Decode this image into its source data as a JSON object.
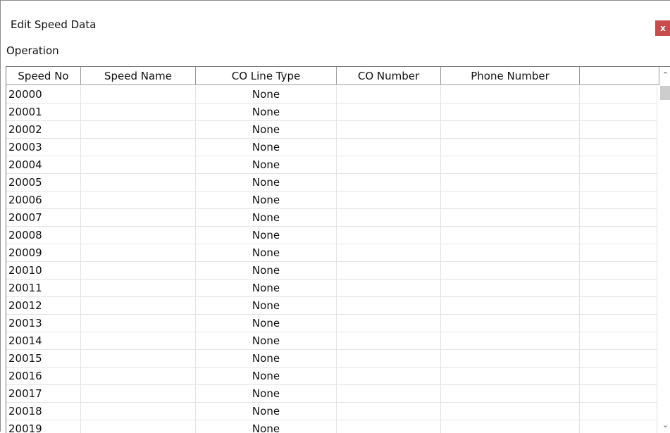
{
  "window": {
    "title": "Edit Speed Data",
    "close_label": "x"
  },
  "menu": {
    "items": [
      "Operation"
    ]
  },
  "table": {
    "columns": [
      "Speed No",
      "Speed Name",
      "CO Line Type",
      "CO Number",
      "Phone Number",
      ""
    ],
    "rows": [
      {
        "speed_no": "20000",
        "speed_name": "",
        "co_line_type": "None",
        "co_number": "",
        "phone_number": ""
      },
      {
        "speed_no": "20001",
        "speed_name": "",
        "co_line_type": "None",
        "co_number": "",
        "phone_number": ""
      },
      {
        "speed_no": "20002",
        "speed_name": "",
        "co_line_type": "None",
        "co_number": "",
        "phone_number": ""
      },
      {
        "speed_no": "20003",
        "speed_name": "",
        "co_line_type": "None",
        "co_number": "",
        "phone_number": ""
      },
      {
        "speed_no": "20004",
        "speed_name": "",
        "co_line_type": "None",
        "co_number": "",
        "phone_number": ""
      },
      {
        "speed_no": "20005",
        "speed_name": "",
        "co_line_type": "None",
        "co_number": "",
        "phone_number": ""
      },
      {
        "speed_no": "20006",
        "speed_name": "",
        "co_line_type": "None",
        "co_number": "",
        "phone_number": ""
      },
      {
        "speed_no": "20007",
        "speed_name": "",
        "co_line_type": "None",
        "co_number": "",
        "phone_number": ""
      },
      {
        "speed_no": "20008",
        "speed_name": "",
        "co_line_type": "None",
        "co_number": "",
        "phone_number": ""
      },
      {
        "speed_no": "20009",
        "speed_name": "",
        "co_line_type": "None",
        "co_number": "",
        "phone_number": ""
      },
      {
        "speed_no": "20010",
        "speed_name": "",
        "co_line_type": "None",
        "co_number": "",
        "phone_number": ""
      },
      {
        "speed_no": "20011",
        "speed_name": "",
        "co_line_type": "None",
        "co_number": "",
        "phone_number": ""
      },
      {
        "speed_no": "20012",
        "speed_name": "",
        "co_line_type": "None",
        "co_number": "",
        "phone_number": ""
      },
      {
        "speed_no": "20013",
        "speed_name": "",
        "co_line_type": "None",
        "co_number": "",
        "phone_number": ""
      },
      {
        "speed_no": "20014",
        "speed_name": "",
        "co_line_type": "None",
        "co_number": "",
        "phone_number": ""
      },
      {
        "speed_no": "20015",
        "speed_name": "",
        "co_line_type": "None",
        "co_number": "",
        "phone_number": ""
      },
      {
        "speed_no": "20016",
        "speed_name": "",
        "co_line_type": "None",
        "co_number": "",
        "phone_number": ""
      },
      {
        "speed_no": "20017",
        "speed_name": "",
        "co_line_type": "None",
        "co_number": "",
        "phone_number": ""
      },
      {
        "speed_no": "20018",
        "speed_name": "",
        "co_line_type": "None",
        "co_number": "",
        "phone_number": ""
      },
      {
        "speed_no": "20019",
        "speed_name": "",
        "co_line_type": "None",
        "co_number": "",
        "phone_number": ""
      }
    ]
  },
  "scrollbar": {
    "up_icon": "chevron-up-icon",
    "down_icon": "chevron-down-icon"
  },
  "colors": {
    "close_button": "#c94c4c",
    "header_border": "#9a9a9a",
    "grid_line": "#e3e3e3",
    "scroll_thumb": "#cdcdcd"
  }
}
